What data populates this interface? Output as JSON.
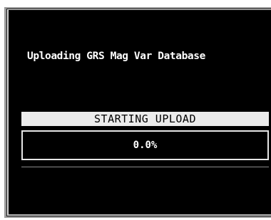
{
  "dialog": {
    "title": "Uploading GRS Mag Var Database",
    "status": "STARTING UPLOAD",
    "progress_text": "0.0%",
    "progress_fraction": 0.0
  },
  "colors": {
    "screen_background": "#000000",
    "text": "#ffffff",
    "status_bar_background": "#ececec",
    "status_bar_text": "#000000",
    "progress_border": "#e6e6e6"
  }
}
